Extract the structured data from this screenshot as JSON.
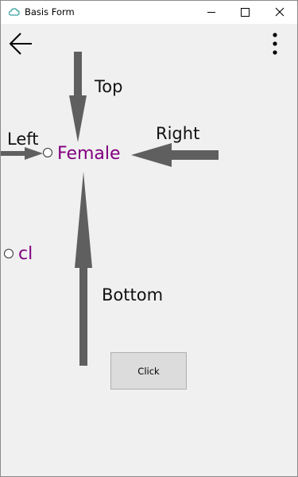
{
  "window": {
    "title": "Basis Form",
    "icons": {
      "app": "cloud-app-icon",
      "minimize": "minimize-icon",
      "maximize": "maximize-icon",
      "close": "close-icon"
    }
  },
  "toolbar": {
    "back_icon": "arrow-left-icon",
    "more_icon": "more-vertical-icon"
  },
  "annotations": {
    "top": "Top",
    "left": "Left",
    "right": "Right",
    "bottom": "Bottom"
  },
  "radios": [
    {
      "label": "Female",
      "selected": false
    },
    {
      "label": "cl",
      "selected": false
    }
  ],
  "click_button": {
    "label": "Click"
  },
  "colors": {
    "accent_text": "#800080",
    "arrow": "#5f5f5f",
    "background": "#f0f0f0",
    "titlebar": "#ffffff"
  }
}
